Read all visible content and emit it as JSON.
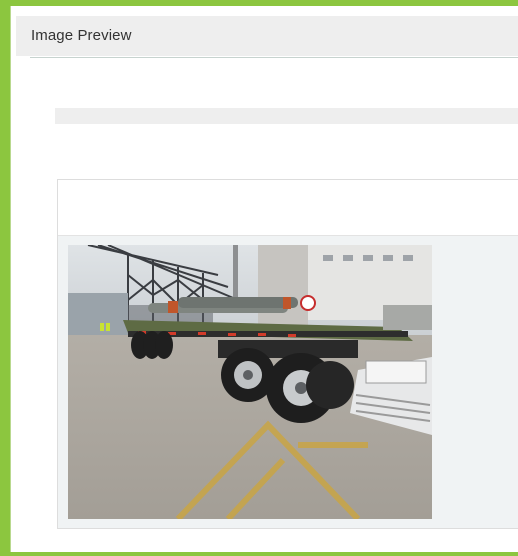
{
  "panel": {
    "title": "Image Preview"
  },
  "image": {
    "name": "flatbed-trailer-photo-icon"
  },
  "colors": {
    "frame_green": "#8cc63f",
    "header_bg": "#eeeeee",
    "card_body_bg": "#f0f3f4"
  }
}
